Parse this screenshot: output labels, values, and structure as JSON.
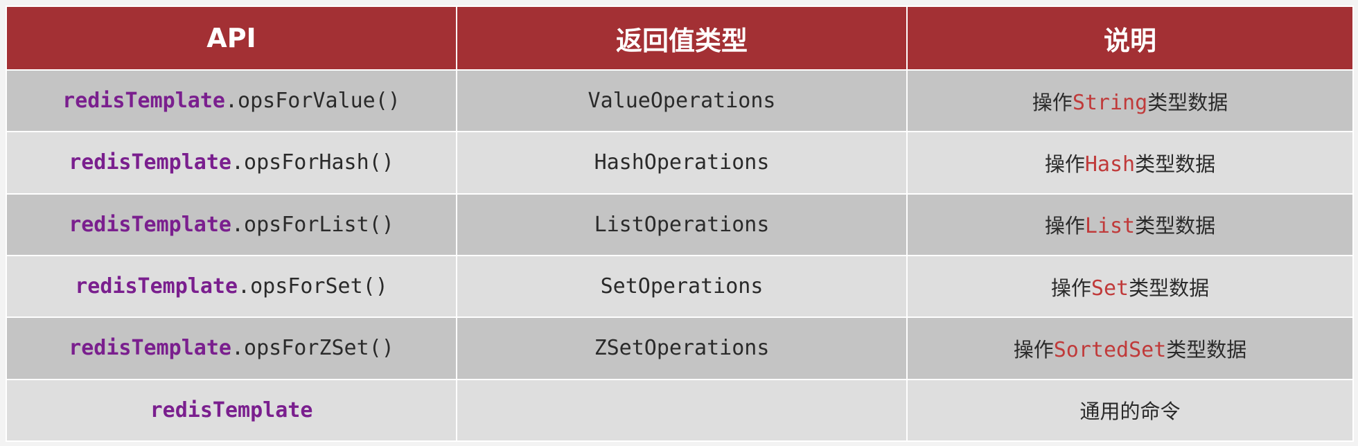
{
  "table": {
    "headers": [
      "API",
      "返回值类型",
      "说明"
    ],
    "rows": [
      {
        "api_object": "redisTemplate",
        "api_method": ".opsForValue()",
        "return_type": "ValueOperations",
        "desc_prefix": "操作",
        "desc_type": "String",
        "desc_suffix": "类型数据"
      },
      {
        "api_object": "redisTemplate",
        "api_method": ".opsForHash()",
        "return_type": "HashOperations",
        "desc_prefix": "操作",
        "desc_type": "Hash",
        "desc_suffix": "类型数据"
      },
      {
        "api_object": "redisTemplate",
        "api_method": ".opsForList()",
        "return_type": "ListOperations",
        "desc_prefix": "操作",
        "desc_type": "List",
        "desc_suffix": "类型数据"
      },
      {
        "api_object": "redisTemplate",
        "api_method": ".opsForSet()",
        "return_type": "SetOperations",
        "desc_prefix": "操作",
        "desc_type": "Set",
        "desc_suffix": "类型数据"
      },
      {
        "api_object": "redisTemplate",
        "api_method": ".opsForZSet()",
        "return_type": "ZSetOperations",
        "desc_prefix": "操作",
        "desc_type": "SortedSet",
        "desc_suffix": "类型数据"
      },
      {
        "api_object": "redisTemplate",
        "api_method": "",
        "return_type": "",
        "desc_prefix": "通用的命令",
        "desc_type": "",
        "desc_suffix": ""
      }
    ]
  },
  "colors": {
    "header_bg": "#a33034",
    "row_dark": "#c4c4c4",
    "row_light": "#dedede",
    "object_text": "#7a1f8e",
    "type_highlight": "#c03a3a"
  }
}
